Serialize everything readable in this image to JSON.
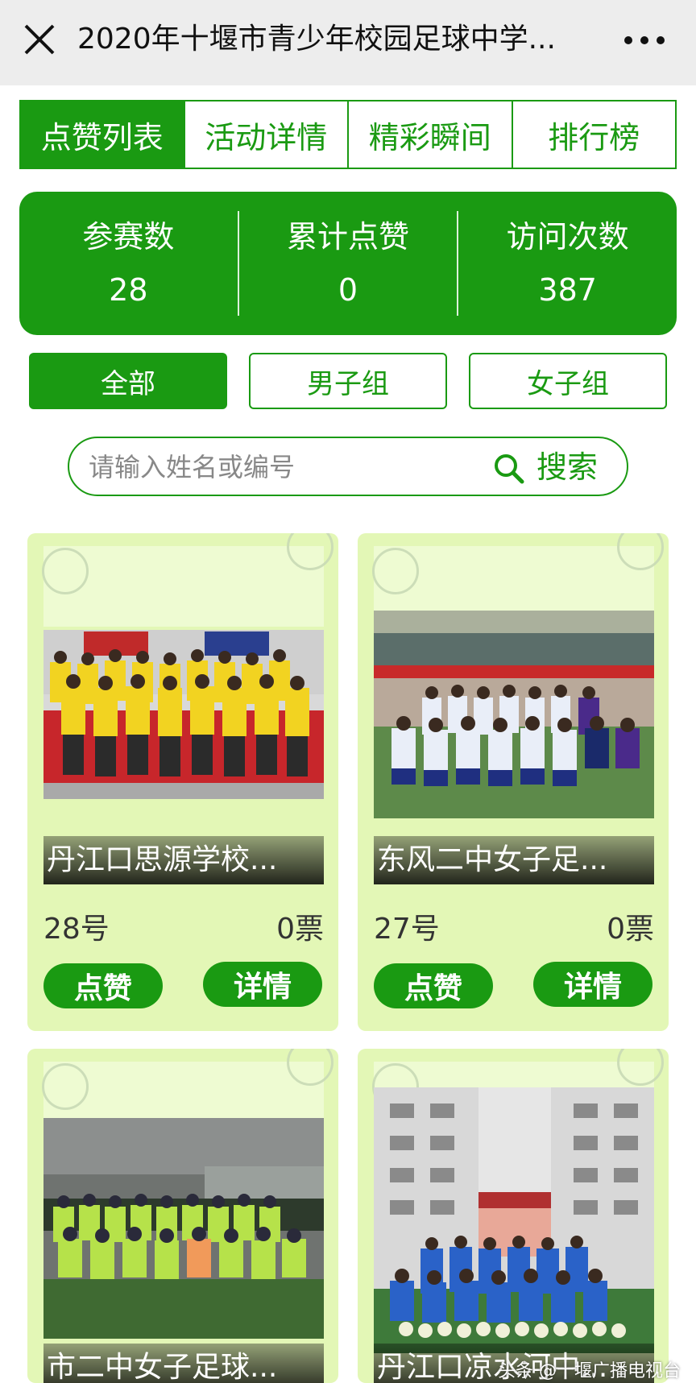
{
  "titlebar": {
    "title": "2020年十堰市青少年校园足球中学...",
    "close_icon": "close-icon",
    "more_icon": "more-icon"
  },
  "tabs": [
    {
      "label": "点赞列表",
      "active": true
    },
    {
      "label": "活动详情",
      "active": false
    },
    {
      "label": "精彩瞬间",
      "active": false
    },
    {
      "label": "排行榜",
      "active": false
    }
  ],
  "stats": [
    {
      "label": "参赛数",
      "value": "28"
    },
    {
      "label": "累计点赞",
      "value": "0"
    },
    {
      "label": "访问次数",
      "value": "387"
    }
  ],
  "filters": [
    {
      "label": "全部",
      "active": true
    },
    {
      "label": "男子组",
      "active": false
    },
    {
      "label": "女子组",
      "active": false
    }
  ],
  "search": {
    "placeholder": "请输入姓名或编号",
    "button_label": "搜索"
  },
  "cards": [
    {
      "name": "丹江口思源学校...",
      "number": "28号",
      "votes": "0票",
      "like_label": "点赞",
      "detail_label": "详情"
    },
    {
      "name": "东风二中女子足...",
      "number": "27号",
      "votes": "0票",
      "like_label": "点赞",
      "detail_label": "详情"
    },
    {
      "name": "市二中女子足球...",
      "number": "",
      "votes": "",
      "like_label": "",
      "detail_label": ""
    },
    {
      "name": "丹江口凉水河中...",
      "number": "",
      "votes": "",
      "like_label": "",
      "detail_label": ""
    }
  ],
  "watermark": "头条 @十堰广播电视台",
  "colors": {
    "accent": "#1a9a12",
    "card_bg": "#e3f7b6"
  }
}
